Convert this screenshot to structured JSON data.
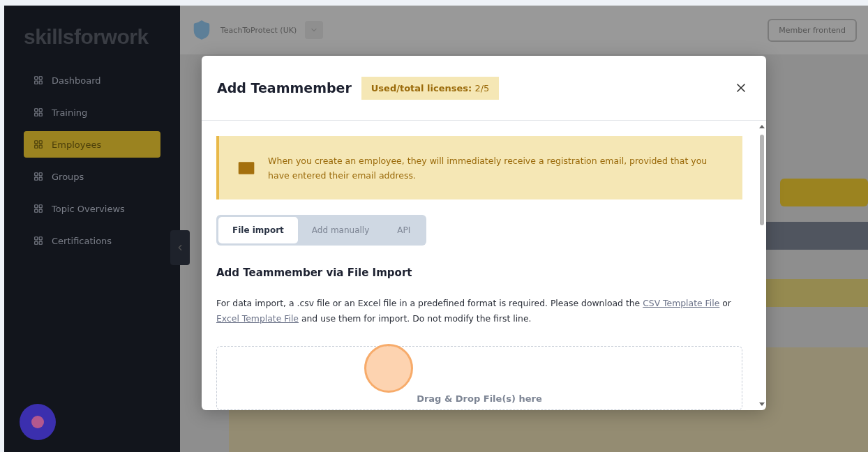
{
  "app": {
    "logo": "skillsforwork",
    "nav": [
      {
        "label": "Dashboard",
        "selected": false
      },
      {
        "label": "Training",
        "selected": false
      },
      {
        "label": "Employees",
        "selected": true
      },
      {
        "label": "Groups",
        "selected": false
      },
      {
        "label": "Topic Overviews",
        "selected": false
      },
      {
        "label": "Certifications",
        "selected": false
      }
    ],
    "organization": "TeachToProtect (UK)",
    "member_frontend_button": "Member frontend"
  },
  "modal": {
    "title": "Add Teammember",
    "license_badge": {
      "label": "Used/total licenses:",
      "value": "2/5"
    },
    "notice": "When you create an employee, they will immediately receive a registration email, provided that you have entered their email address.",
    "tabs": [
      {
        "label": "File import",
        "selected": true
      },
      {
        "label": "Add manually",
        "selected": false
      },
      {
        "label": "API",
        "selected": false
      }
    ],
    "section_title": "Add Teammember via File Import",
    "description": {
      "before": "For data import, a .csv file or an Excel file in a predefined format is required. Please download the ",
      "link1": "CSV Template File",
      "middle": " or ",
      "link2": "Excel Template File",
      "after": " and use them for import. Do not modify the first line."
    },
    "dropzone": "Drag & Drop File(s) here"
  }
}
